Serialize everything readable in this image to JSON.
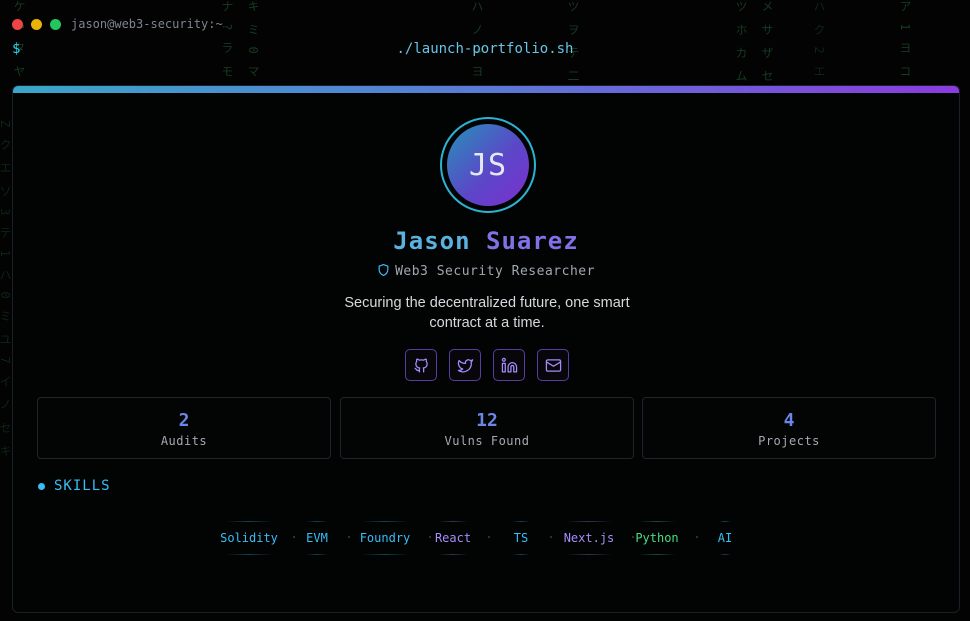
{
  "window": {
    "title": "jason@web3-security:~"
  },
  "terminal": {
    "prompt": "$",
    "command": "./launch-portfolio.sh"
  },
  "profile": {
    "initials": "JS",
    "first_name": "Jason",
    "last_name": "Suarez",
    "role": "Web3 Security Researcher",
    "tagline": "Securing the decentralized future, one smart contract at a time."
  },
  "socials": [
    {
      "name": "github-icon"
    },
    {
      "name": "twitter-icon"
    },
    {
      "name": "linkedin-icon"
    },
    {
      "name": "mail-icon"
    }
  ],
  "stats": [
    {
      "value": "2",
      "label": "Audits"
    },
    {
      "value": "12",
      "label": "Vulns Found"
    },
    {
      "value": "4",
      "label": "Projects"
    }
  ],
  "skills": {
    "heading": "SKILLS",
    "items": [
      {
        "label": "Solidity",
        "color": "#38bdf8"
      },
      {
        "label": "EVM",
        "color": "#38bdf8"
      },
      {
        "label": "Foundry",
        "color": "#38bdf8"
      },
      {
        "label": "React",
        "color": "#a78bfa"
      },
      {
        "label": "TS",
        "color": "#38bdf8"
      },
      {
        "label": "Next.js",
        "color": "#a78bfa"
      },
      {
        "label": "Python",
        "color": "#4ade80"
      },
      {
        "label": "AI",
        "color": "#38bdf8"
      }
    ]
  },
  "colors": {
    "accent_cyan": "#38bdf8",
    "accent_purple": "#8b3bdf",
    "stat_value": "#6b86e8"
  }
}
